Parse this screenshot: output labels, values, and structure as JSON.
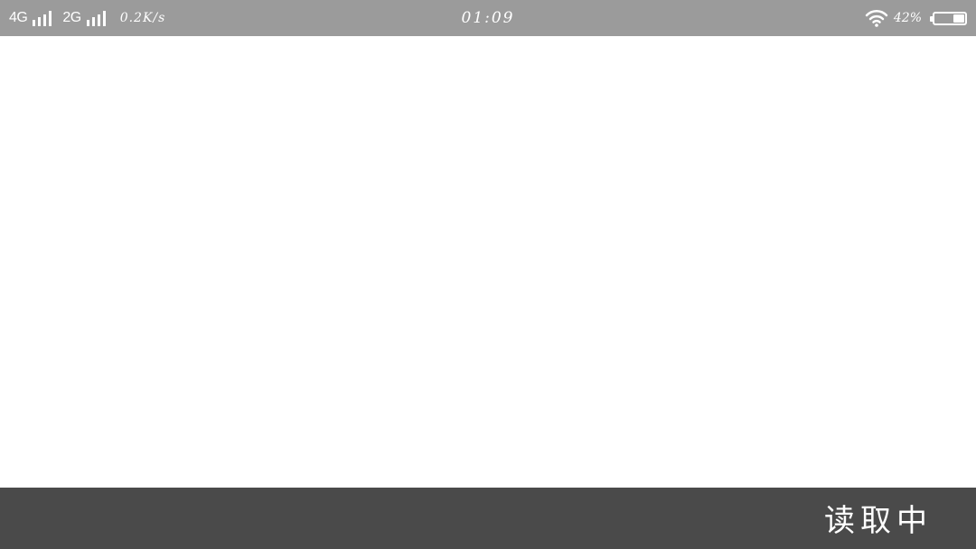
{
  "status_bar": {
    "network_1": "4G",
    "network_2": "2G",
    "speed": "0.2K/s",
    "time": "01:09",
    "battery_percent": "42%",
    "battery_level": 0.42,
    "icons": [
      "signal-bars-icon",
      "wifi-icon",
      "battery-icon"
    ],
    "background": "#9b9b9b"
  },
  "bottom_bar": {
    "status_text": "读取中",
    "background": "#4a4a4a"
  }
}
